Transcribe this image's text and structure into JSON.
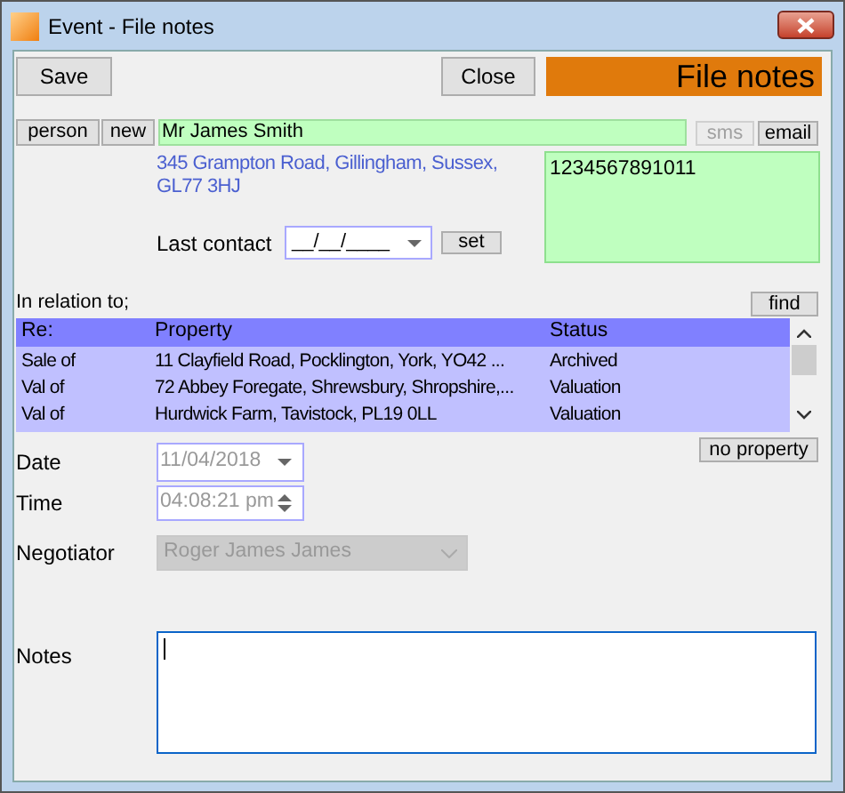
{
  "window": {
    "title": "Event - File notes"
  },
  "toolbar": {
    "save_button": "Save",
    "close_button": "Close",
    "heading": "File notes"
  },
  "contact": {
    "person_button": "person",
    "new_button": "new",
    "name": "Mr James Smith",
    "sms_button": {
      "label": "sms",
      "disabled": true
    },
    "email_button": {
      "label": "email",
      "disabled": false
    },
    "address": "345 Grampton Road, Gillingham, Sussex, GL77 3HJ",
    "phone": "1234567891011",
    "last_contact": {
      "label": "Last contact",
      "value": "__/__/____"
    },
    "set_button": "set"
  },
  "relation": {
    "label": "In relation to;",
    "find_button": "find",
    "columns": [
      "Re:",
      "Property",
      "Status"
    ],
    "rows": [
      [
        "Sale of",
        "11 Clayfield Road, Pocklington, York, YO42 ...",
        "Archived"
      ],
      [
        "Val of",
        "72 Abbey Foregate, Shrewsbury, Shropshire,...",
        "Valuation"
      ],
      [
        "Val of",
        "Hurdwick Farm, Tavistock, PL19 0LL",
        "Valuation"
      ]
    ],
    "no_property_button": "no property"
  },
  "date": {
    "label": "Date",
    "value": "11/04/2018",
    "disabled": true
  },
  "time": {
    "label": "Time",
    "value": "04:08:21 pm",
    "disabled": true
  },
  "negotiator": {
    "label": "Negotiator",
    "value": "Roger James James",
    "disabled": true
  },
  "notes": {
    "label": "Notes"
  }
}
